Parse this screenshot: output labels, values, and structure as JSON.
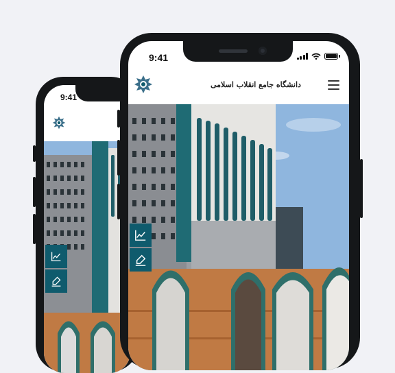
{
  "status_bar": {
    "time": "9:41"
  },
  "header": {
    "title": "دانشگاه جامع انقلاب اسلامی"
  },
  "icons": {
    "logo": "university-logo-icon",
    "menu": "hamburger-menu-icon",
    "chart": "line-chart-icon",
    "pen": "pen-sign-icon",
    "signal": "cellular-signal-icon",
    "wifi": "wifi-icon",
    "battery": "battery-icon"
  },
  "colors": {
    "accent": "#0f5b6d",
    "sky": "#8fb6de",
    "brick": "#c07a44",
    "teal_glass": "#1f6b74"
  }
}
